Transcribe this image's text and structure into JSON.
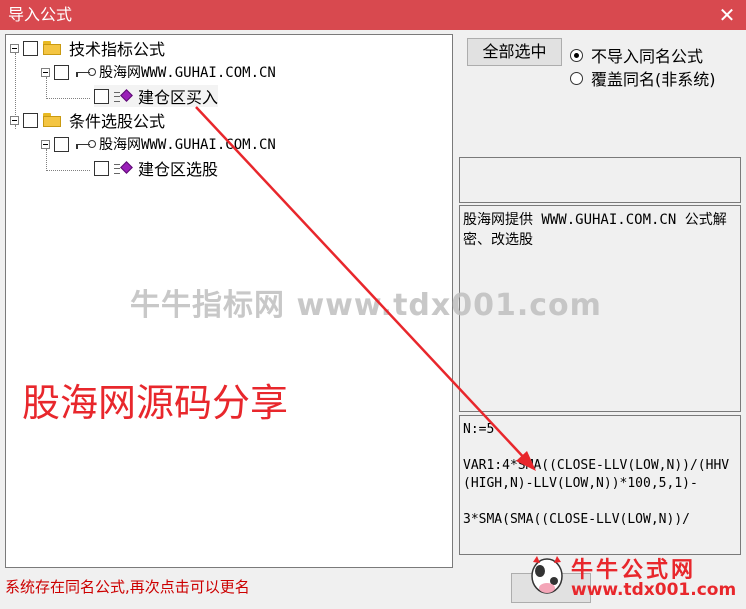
{
  "window": {
    "title": "导入公式",
    "close_glyph": "✕"
  },
  "tree": {
    "group1": {
      "label": "技术指标公式"
    },
    "author1": {
      "label": "股海网WWW.GUHAI.COM.CN"
    },
    "item1": {
      "label": "建仓区买入"
    },
    "group2": {
      "label": "条件选股公式"
    },
    "author2": {
      "label": "股海网WWW.GUHAI.COM.CN"
    },
    "item2": {
      "label": "建仓区选股"
    }
  },
  "controls": {
    "select_all": "全部选中",
    "radio_no_import": "不导入同名公式",
    "radio_overwrite": "覆盖同名(非系统)",
    "selected_option": "radio_no_import"
  },
  "description": "股海网提供 WWW.GUHAI.COM.CN 公式解密、改选股",
  "source_code": "N:=5\n\nVAR1:4*SMA((CLOSE-LLV(LOW,N))/(HHV(HIGH,N)-LLV(LOW,N))*100,5,1)-\n\n3*SMA(SMA((CLOSE-LLV(LOW,N))/",
  "status": "系统存在同名公式,再次点击可以更名",
  "overlay": {
    "watermark": "牛牛指标网 www.tdx001.com",
    "share_text": "股海网源码分享",
    "logo_title": "牛牛公式网",
    "logo_url": "www.tdx001.com"
  },
  "colors": {
    "titlebar": "#d8494f",
    "accent_red": "#e8272c",
    "status_red": "#cc0000",
    "gem_purple": "#9a1fb8"
  }
}
